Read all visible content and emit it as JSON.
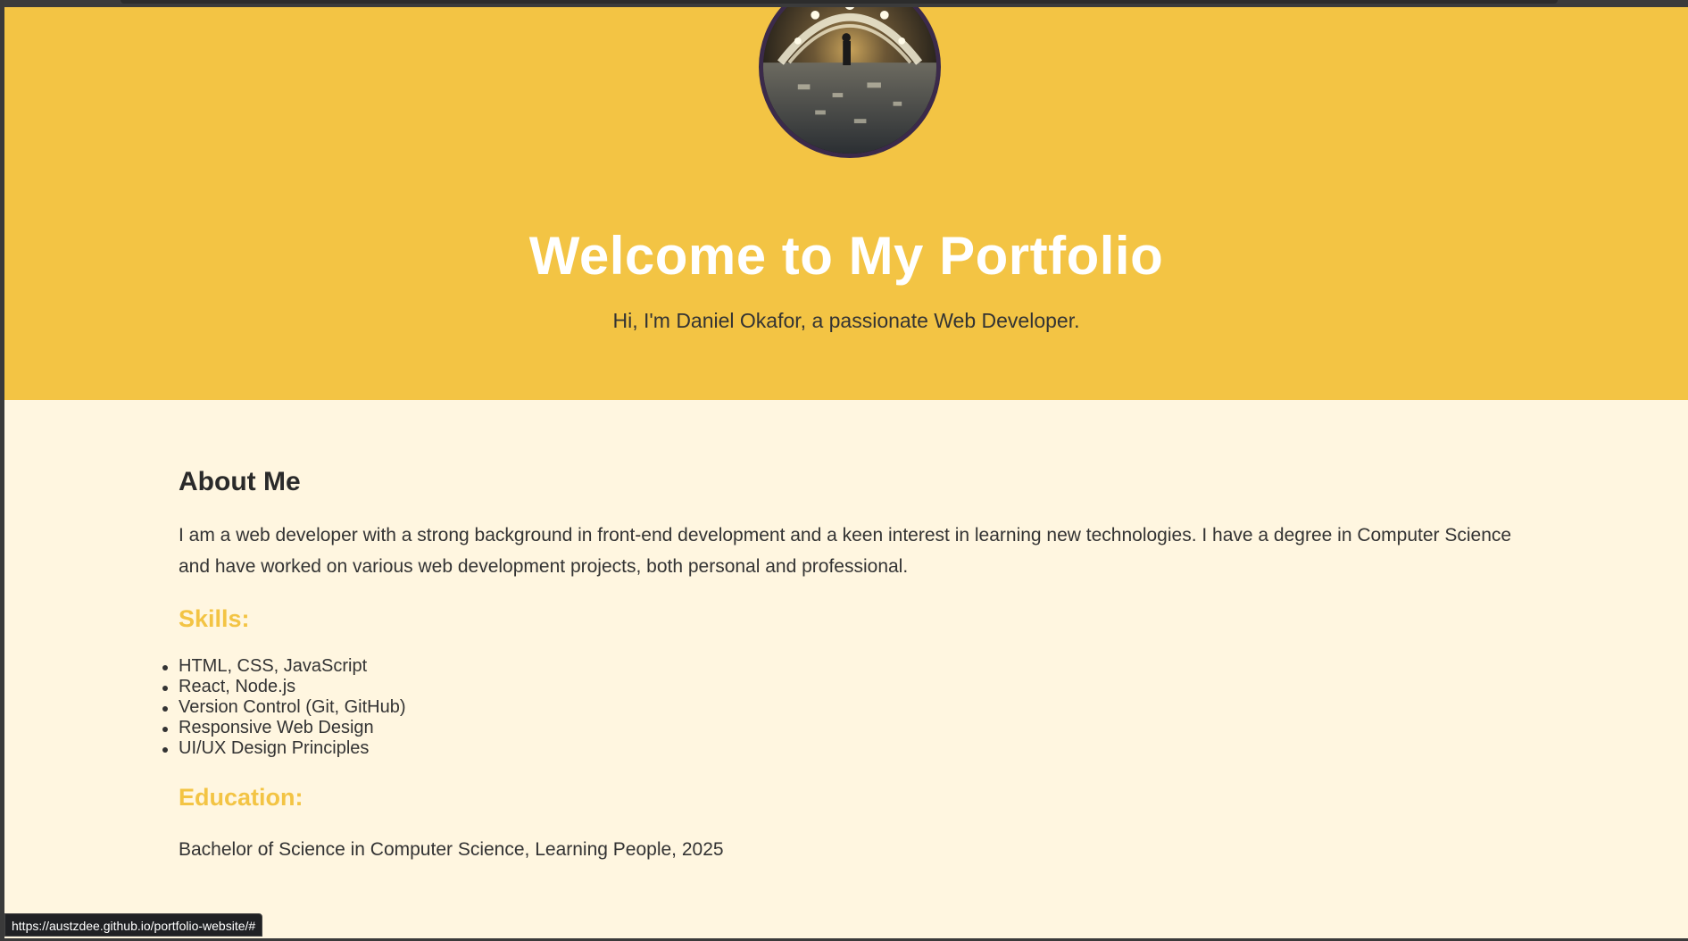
{
  "hero": {
    "title": "Welcome to My Portfolio",
    "subtitle": "Hi, I'm Daniel Okafor, a passionate Web Developer.",
    "avatar_icon": "profile-photo"
  },
  "about": {
    "heading": "About Me",
    "text": "I am a web developer with a strong background in front-end development and a keen interest in learning new technologies. I have a degree in Computer Science and have worked on various web development projects, both personal and professional."
  },
  "skills": {
    "heading": "Skills:",
    "items": [
      "HTML, CSS, JavaScript",
      "React, Node.js",
      "Version Control (Git, GitHub)",
      "Responsive Web Design",
      "UI/UX Design Principles"
    ]
  },
  "education": {
    "heading": "Education:",
    "text": "Bachelor of Science in Computer Science, Learning People, 2025"
  },
  "status_bar": {
    "url": "https://austzdee.github.io/portfolio-website/#"
  },
  "colors": {
    "hero_bg": "#f3c444",
    "page_bg": "#fff6e0",
    "accent": "#f3c444",
    "text": "#333333"
  }
}
